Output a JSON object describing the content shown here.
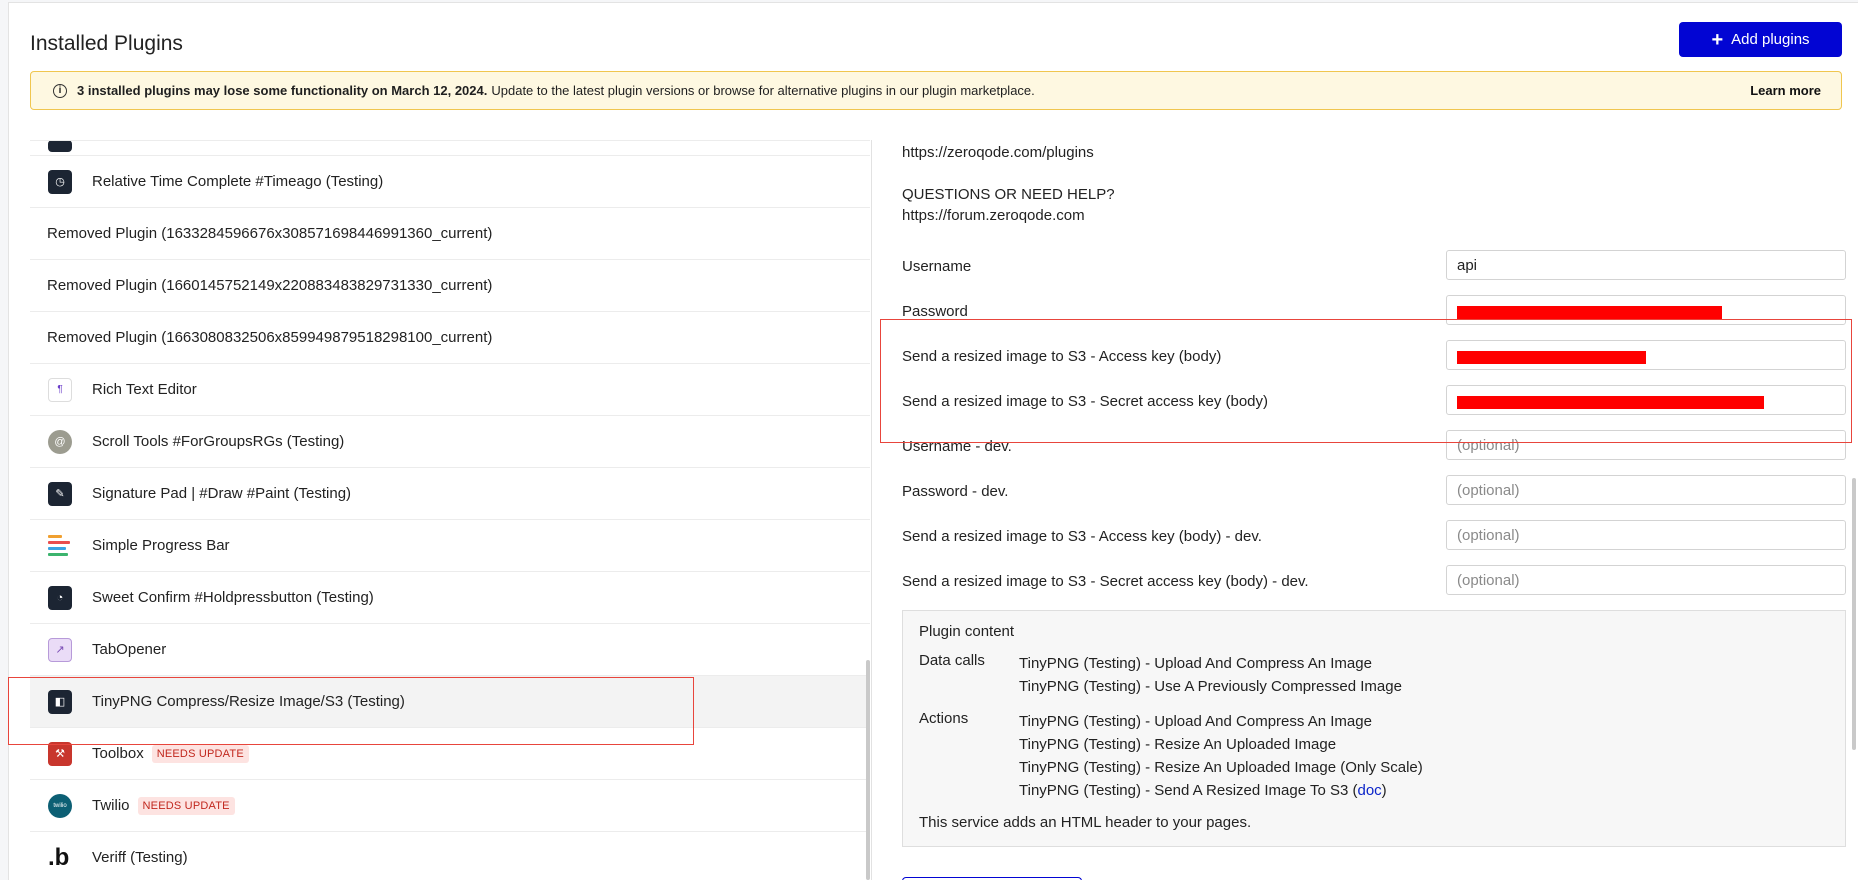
{
  "header": {
    "title": "Installed Plugins",
    "add_button": "Add plugins"
  },
  "banner": {
    "bold_text": "3 installed plugins may lose some functionality on March 12, 2024.",
    "text": "Update to the latest plugin versions or browse for alternative plugins in our plugin marketplace.",
    "link": "Learn more"
  },
  "plugins": [
    {
      "label": "Relative Time Complete #Timeago (Testing)",
      "icon": "clock-plugin-icon"
    },
    {
      "label": "Removed Plugin (1633284596676x308571698446991360_current)",
      "icon": ""
    },
    {
      "label": "Removed Plugin (1660145752149x220883483829731330_current)",
      "icon": ""
    },
    {
      "label": "Removed Plugin (1663080832506x859949879518298100_current)",
      "icon": ""
    },
    {
      "label": "Rich Text Editor",
      "icon": "rich-text-icon"
    },
    {
      "label": "Scroll Tools #ForGroupsRGs (Testing)",
      "icon": "scroll-tools-icon"
    },
    {
      "label": "Signature Pad | #Draw #Paint (Testing)",
      "icon": "signature-pad-icon"
    },
    {
      "label": "Simple Progress Bar",
      "icon": "progress-bar-icon"
    },
    {
      "label": "Sweet Confirm #Holdpressbutton (Testing)",
      "icon": "sweet-confirm-icon"
    },
    {
      "label": "TabOpener",
      "icon": "tab-opener-icon"
    },
    {
      "label": "TinyPNG Compress/Resize Image/S3 (Testing)",
      "icon": "tinypng-icon"
    },
    {
      "label": "Toolbox",
      "icon": "toolbox-icon",
      "badge": "NEEDS UPDATE"
    },
    {
      "label": "Twilio",
      "icon": "twilio-icon",
      "badge": "NEEDS UPDATE"
    },
    {
      "label": "Veriff (Testing)",
      "icon": "veriff-icon"
    }
  ],
  "detail": {
    "url1": "https://zeroqode.com/plugins",
    "help_heading": "QUESTIONS OR NEED HELP?",
    "help_url": "https://forum.zeroqode.com",
    "fields": [
      {
        "label": "Username",
        "value": "api",
        "placeholder": ""
      },
      {
        "label": "Password",
        "value": "",
        "placeholder": ""
      },
      {
        "label": "Send a resized image to S3 - Access key (body)",
        "value": "",
        "placeholder": ""
      },
      {
        "label": "Send a resized image to S3 - Secret access key (body)",
        "value": "",
        "placeholder": ""
      },
      {
        "label": "Username - dev.",
        "value": "",
        "placeholder": "(optional)"
      },
      {
        "label": "Password - dev.",
        "value": "",
        "placeholder": "(optional)"
      },
      {
        "label": "Send a resized image to S3 - Access key (body) - dev.",
        "value": "",
        "placeholder": "(optional)"
      },
      {
        "label": "Send a resized image to S3 - Secret access key (body) - dev.",
        "value": "",
        "placeholder": "(optional)"
      }
    ],
    "content": {
      "title": "Plugin content",
      "data_calls_label": "Data calls",
      "data_calls": [
        "TinyPNG (Testing) - Upload And Compress An Image",
        "TinyPNG (Testing) - Use A Previously Compressed Image"
      ],
      "actions_label": "Actions",
      "actions": [
        "TinyPNG (Testing) - Upload And Compress An Image",
        "TinyPNG (Testing) - Resize An Uploaded Image",
        "TinyPNG (Testing) - Resize An Uploaded Image (Only Scale)"
      ],
      "last_action_prefix": "TinyPNG (Testing) - Send A Resized Image To S3 (",
      "last_action_link": "doc",
      "last_action_suffix": ")",
      "footer": "This service adds an HTML header to your pages."
    }
  },
  "colors": {
    "primary": "#0205d3",
    "banner_bg": "#fef8e1",
    "banner_border": "#f0c64f",
    "badge_text": "#c1271d",
    "highlight": "#e8453c",
    "redaction": "#ff0000"
  }
}
